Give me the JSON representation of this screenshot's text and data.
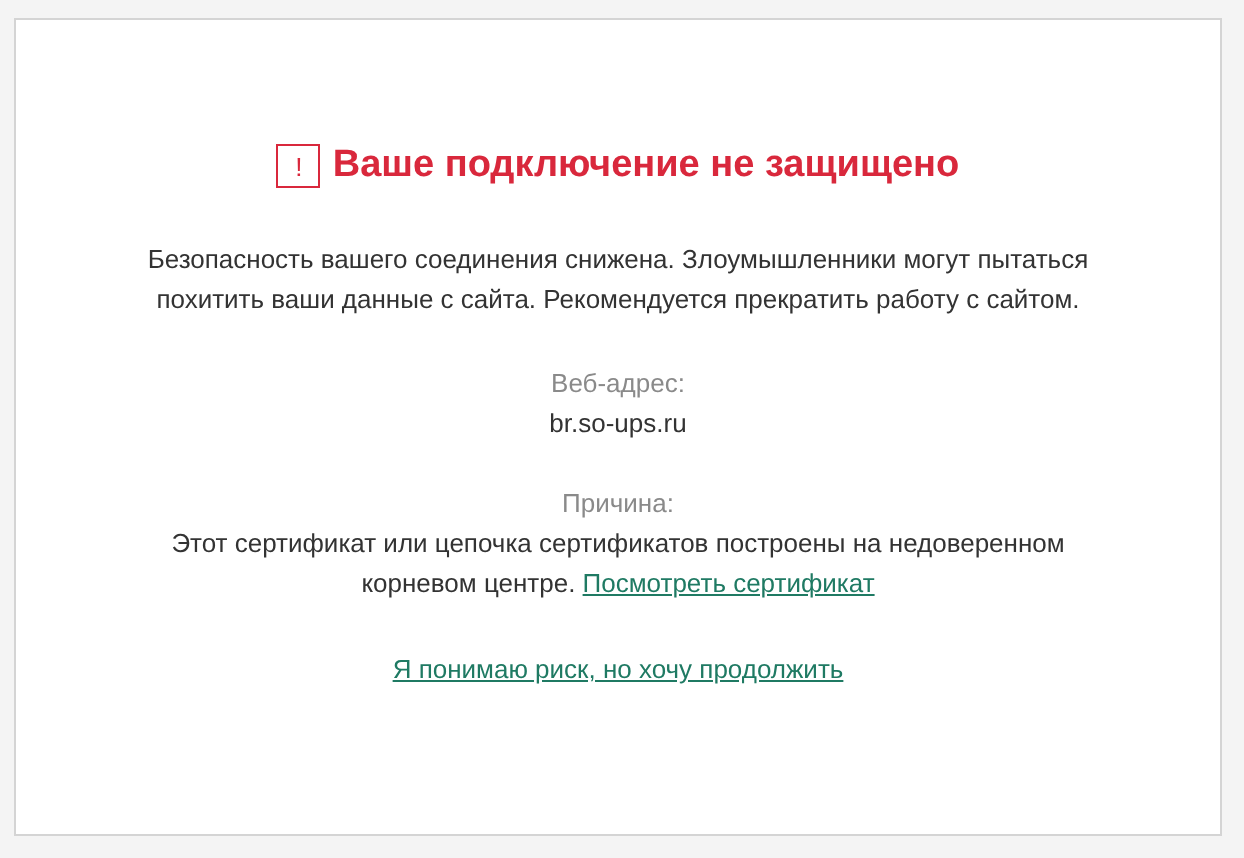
{
  "warning": {
    "icon": "!",
    "title": "Ваше подключение не защищено"
  },
  "description": "Безопасность вашего соединения снижена. Злоумышленники могут пытаться похитить ваши данные с сайта. Рекомендуется прекратить работу с сайтом.",
  "address": {
    "label": "Веб-адрес:",
    "value": "br.so-ups.ru"
  },
  "reason": {
    "label": "Причина:",
    "text": "Этот сертификат или цепочка сертификатов построены на недоверенном корневом центре.",
    "link": "Посмотреть сертификат"
  },
  "continue_link": "Я понимаю риск, но хочу продолжить"
}
